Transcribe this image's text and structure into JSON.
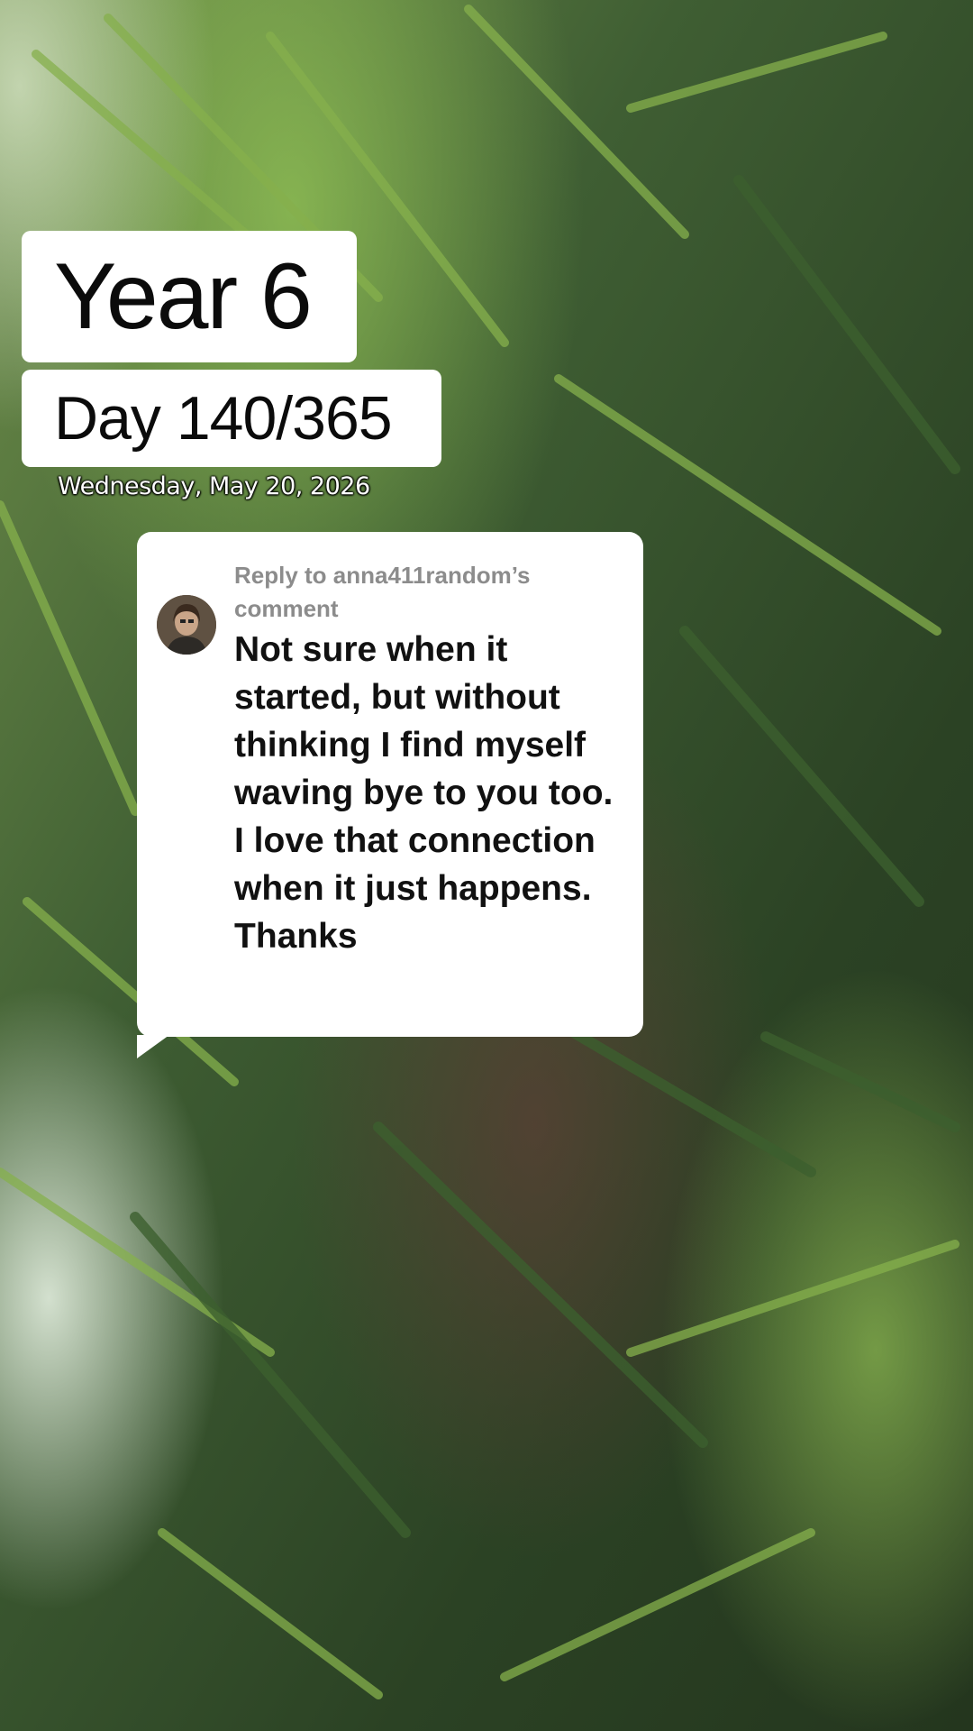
{
  "header": {
    "year_label": "Year 6",
    "day_label": "Day 140/365",
    "date": "Wednesday, May 20, 2026"
  },
  "reply": {
    "reply_to": "Reply to anna411random’s comment",
    "comment": "Not sure when it started, but without thinking I find myself waving bye to you too. I love that connection when it just happens. Thanks"
  },
  "colors": {
    "card_background": "#ffffff",
    "reply_to_text": "#8c8c8c",
    "comment_text": "#111111",
    "date_text": "#ffffff"
  },
  "icons": {
    "avatar": "commenter-avatar"
  }
}
